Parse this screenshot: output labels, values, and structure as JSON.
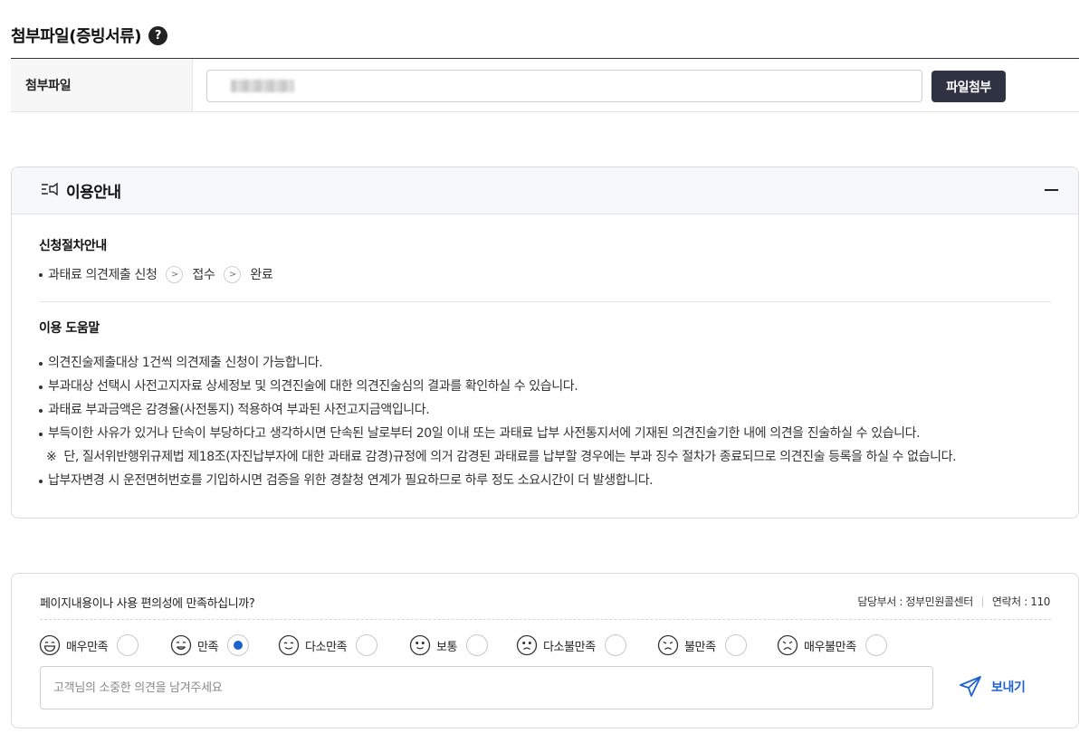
{
  "attach": {
    "section_title": "첨부파일(증빙서류)",
    "help_icon": "?",
    "row_label": "첨부파일",
    "file_value": "",
    "button_label": "파일첨부"
  },
  "guide": {
    "title": "이용안내",
    "title_icon": "announcement-icon",
    "collapse_icon": "minus-icon",
    "procedure_title": "신청절차안내",
    "steps": [
      "과태료 의견제출 신청",
      "접수",
      "완료"
    ],
    "help_title": "이용 도움말",
    "tips": [
      "의견진술제출대상 1건씩 의견제출 신청이 가능합니다.",
      "부과대상 선택시 사전고지자료 상세정보 및 의견진술에 대한 의견진술심의 결과를 확인하실 수 있습니다.",
      "과태료 부과금액은 감경율(사전통지) 적용하여 부과된 사전고지금액입니다.",
      "부득이한 사유가 있거나 단속이 부당하다고 생각하시면 단속된 날로부터 20일 이내 또는 과태료 납부 사전통지서에 기재된 의견진술기한 내에 의견을 진술하실 수 있습니다."
    ],
    "note_mark": "※",
    "note": "단, 질서위반행위규제법 제18조(자진납부자에 대한 과태료 감경)규정에 의거 감경된 과태료를 납부할 경우에는 부과 징수 절차가 종료되므로 의견진술 등록을 하실 수 없습니다.",
    "last_tip": "납부자변경 시 운전면허번호를 기입하시면 검증을 위한 경찰청 연계가 필요하므로 하루 정도 소요시간이 더 발생합니다."
  },
  "survey": {
    "question": "페이지내용이나 사용 편의성에 만족하십니까?",
    "dept": "담당부서 : 정부민원콜센터",
    "contact": "연락처 : 110",
    "options": [
      {
        "label": "매우만족",
        "icon": "very-satisfied-face-icon",
        "checked": false
      },
      {
        "label": "만족",
        "icon": "satisfied-face-icon",
        "checked": true
      },
      {
        "label": "다소만족",
        "icon": "somewhat-satisfied-face-icon",
        "checked": false
      },
      {
        "label": "보통",
        "icon": "neutral-face-icon",
        "checked": false
      },
      {
        "label": "다소불만족",
        "icon": "somewhat-dissatisfied-face-icon",
        "checked": false
      },
      {
        "label": "불만족",
        "icon": "dissatisfied-face-icon",
        "checked": false
      },
      {
        "label": "매우불만족",
        "icon": "very-dissatisfied-face-icon",
        "checked": false
      }
    ],
    "placeholder": "고객님의 소중한 의견을 남겨주세요",
    "send_label": "보내기",
    "send_icon": "paper-plane-icon",
    "accent_color": "#1e62d0"
  }
}
